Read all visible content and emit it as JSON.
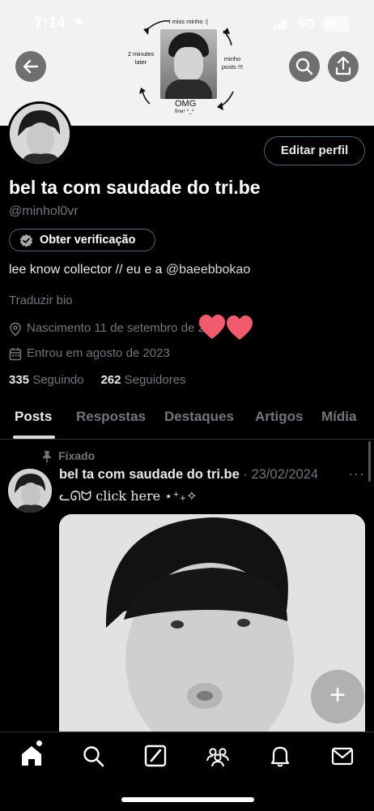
{
  "status_bar": {
    "time": "7:14",
    "network": "5G",
    "battery": "50"
  },
  "banner": {
    "caption_top": "i miss minho :(",
    "caption_left": "2 minutes later",
    "caption_right": "minho posts !!!",
    "caption_bottom": "OMG",
    "caption_fine": "fine! ^_^"
  },
  "header": {
    "back_icon": "arrow-left-icon",
    "search_icon": "search-icon",
    "share_icon": "share-icon"
  },
  "profile": {
    "edit_button": "Editar perfil",
    "name": "bel ta com saudade do tri.be",
    "handle": "@minhol0vr",
    "verify_button": "Obter verificação",
    "bio_prefix": "lee know collector // eu e a ",
    "bio_mention": "@baeebbokao",
    "translate": "Traduzir bio",
    "birthday": "Nascimento 11 de setembro de 20",
    "joined": "Entrou em agosto de 2023",
    "following_count": "335",
    "following_label": "Seguindo",
    "followers_count": "262",
    "followers_label": "Seguidores"
  },
  "tabs": [
    "Posts",
    "Respostas",
    "Destaques",
    "Artigos",
    "Mídia"
  ],
  "pinned_post": {
    "pinned_label": "Fixado",
    "author": "bel ta com saudade do tri.be",
    "date": "· 23/02/2024",
    "text": "ᓚᘏᗢ click here ⋆⁺₊✧",
    "more": "···"
  },
  "fab_label": "+",
  "bottom_nav": [
    "home-icon",
    "search-icon",
    "grok-icon",
    "communities-icon",
    "notifications-icon",
    "messages-icon"
  ],
  "colors": {
    "background": "#000000",
    "text": "#e7e9ea",
    "muted": "#71767b",
    "border": "#2f3336",
    "heart": "#f25a6e"
  }
}
